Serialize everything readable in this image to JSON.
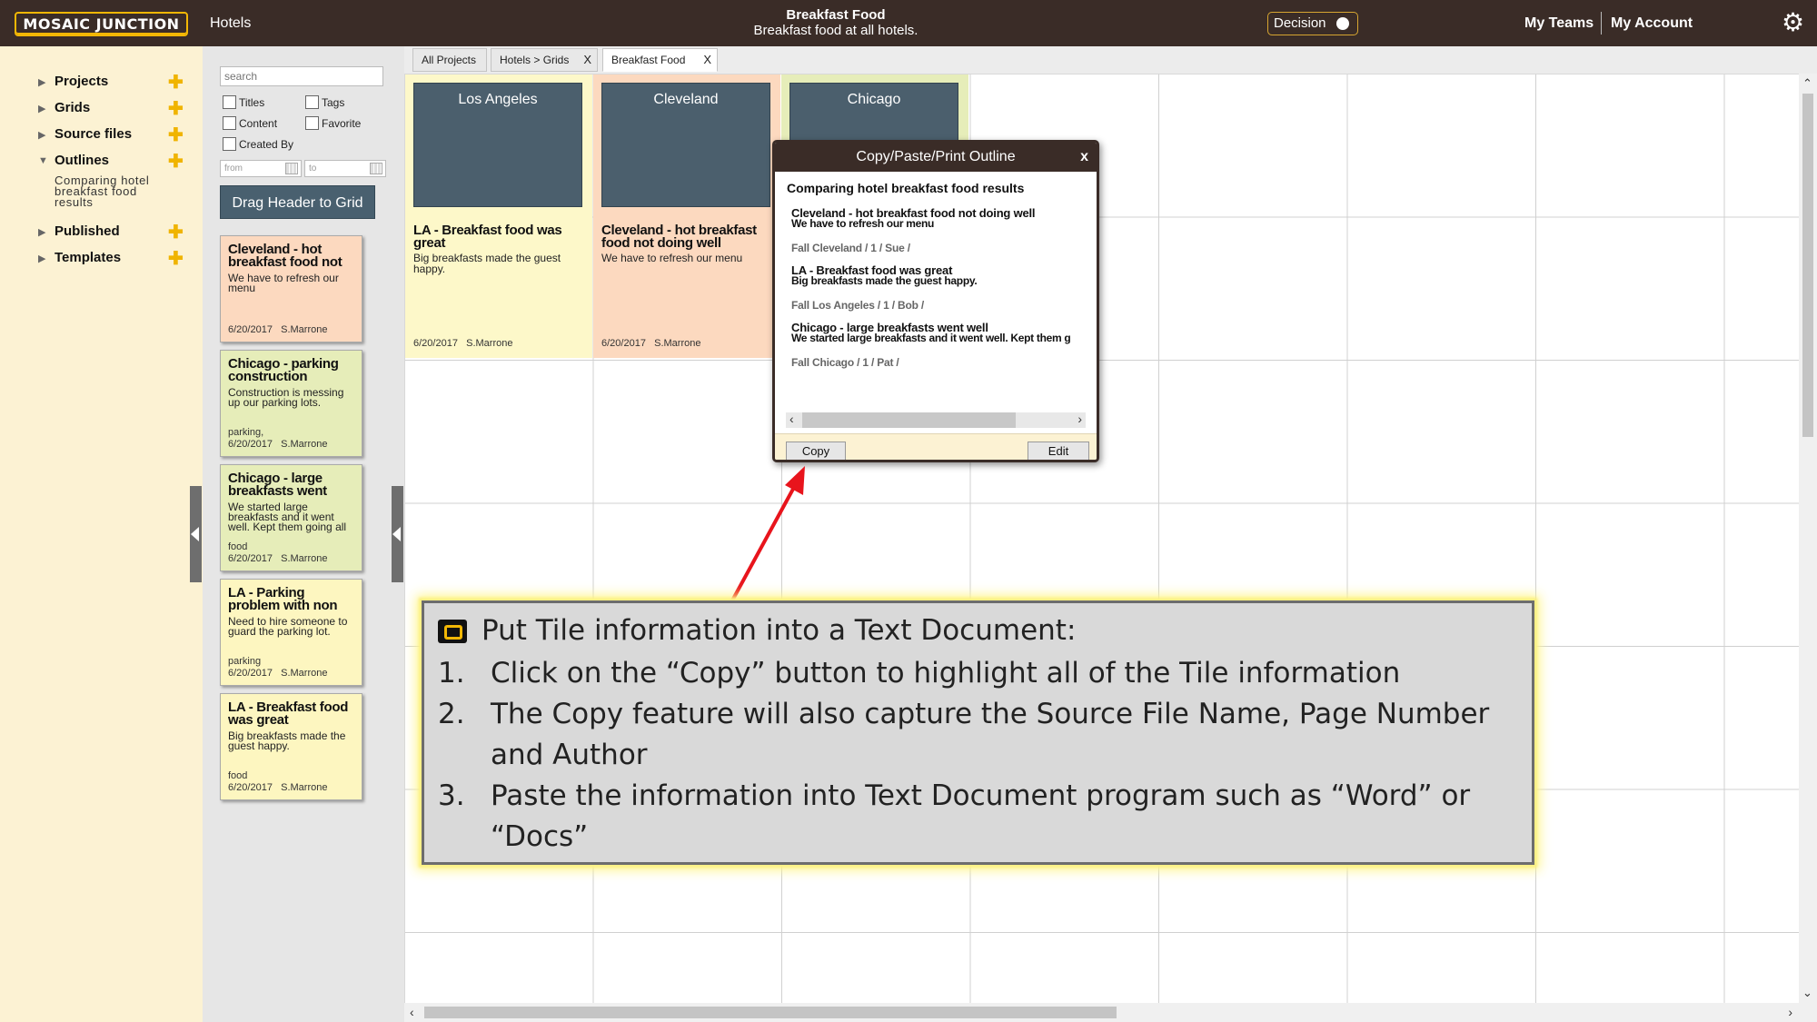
{
  "header": {
    "logo": "MOSAIC JUNCTION",
    "nav_hotels": "Hotels",
    "title": "Breakfast Food",
    "subtitle": "Breakfast food at all hotels.",
    "decision": "Decision",
    "my_teams": "My Teams",
    "my_account": "My Account",
    "gear_icon": "gear-icon"
  },
  "sidebar": {
    "items": [
      {
        "label": "Projects",
        "expanded": false
      },
      {
        "label": "Grids",
        "expanded": false
      },
      {
        "label": "Source files",
        "expanded": false
      },
      {
        "label": "Outlines",
        "expanded": true
      },
      {
        "label": "Published",
        "expanded": false
      },
      {
        "label": "Templates",
        "expanded": false
      }
    ],
    "outline_entry": "Comparing hotel breakfast food results"
  },
  "filters": {
    "search_placeholder": "search",
    "titles": "Titles",
    "tags": "Tags",
    "content": "Content",
    "favorite": "Favorite",
    "created_by": "Created By",
    "from_placeholder": "from",
    "to_placeholder": "to",
    "drag_header": "Drag Header to Grid"
  },
  "side_tiles": [
    {
      "title": "Cleveland - hot breakfast food not",
      "body": "We have to refresh our menu",
      "tag": "",
      "date": "6/20/2017",
      "author": "S.Marrone",
      "color": "#fcd9bf"
    },
    {
      "title": "Chicago - parking construction",
      "body": "Construction is messing up our parking lots.",
      "tag": "parking,",
      "date": "6/20/2017",
      "author": "S.Marrone",
      "color": "#e6edb9"
    },
    {
      "title": "Chicago - large breakfasts went",
      "body": "We started large breakfasts and it went well. Kept them going all",
      "tag": "food",
      "date": "6/20/2017",
      "author": "S.Marrone",
      "color": "#e6edb9"
    },
    {
      "title": "LA - Parking problem with non",
      "body": "Need to hire someone to guard the parking lot.",
      "tag": "parking",
      "date": "6/20/2017",
      "author": "S.Marrone",
      "color": "#fdf6c0"
    },
    {
      "title": "LA - Breakfast food was great",
      "body": "Big breakfasts made the guest happy.",
      "tag": "food",
      "date": "6/20/2017",
      "author": "S.Marrone",
      "color": "#fdf6c0"
    }
  ],
  "tabs": [
    {
      "label": "All Projects",
      "closable": false
    },
    {
      "label": "Hotels > Grids",
      "closable": true
    },
    {
      "label": "Breakfast Food",
      "closable": true
    }
  ],
  "tab_close": "X",
  "grid": {
    "columns": [
      {
        "header": "Los Angeles",
        "color": "#fdf8c9"
      },
      {
        "header": "Cleveland",
        "color": "#fcd9bf"
      },
      {
        "header": "Chicago",
        "color": "#e6edb9"
      }
    ],
    "tiles": [
      {
        "title": "LA - Breakfast food was great",
        "body": "Big breakfasts made the guest happy.",
        "date": "6/20/2017",
        "author": "S.Marrone"
      },
      {
        "title": "Cleveland - hot breakfast food not doing well",
        "body": "We have to refresh our menu",
        "date": "6/20/2017",
        "author": "S.Marrone"
      }
    ]
  },
  "popup": {
    "title": "Copy/Paste/Print Outline",
    "close": "x",
    "heading": "Comparing hotel breakfast food results",
    "entries": [
      {
        "title": "Cleveland - hot breakfast food not doing well",
        "body": "We have to refresh our menu",
        "source": "Fall Cleveland / 1 / Sue /"
      },
      {
        "title": "LA - Breakfast food was great",
        "body": "Big breakfasts made the guest happy.",
        "source": "Fall Los Angeles / 1 / Bob /"
      },
      {
        "title": "Chicago - large breakfasts went well",
        "body": "We started large breakfasts and it went well. Kept them g",
        "source": "Fall Chicago / 1 / Pat /"
      }
    ],
    "copy_button": "Copy",
    "edit_button": "Edit"
  },
  "instructions": {
    "title": "Put Tile information into a Text Document:",
    "steps": [
      {
        "num": "1.",
        "text": "Click on the “Copy” button to highlight all of the Tile information"
      },
      {
        "num": "2.",
        "text": "The Copy feature will also capture the Source File Name, Page Number and Author"
      },
      {
        "num": "3.",
        "text": "Paste the information into Text Document program such as “Word” or “Docs”"
      }
    ]
  },
  "colors": {
    "header_bg": "#3a2c27",
    "accent": "#f2b705",
    "nav_bg": "#fcf2d3",
    "column_header": "#4b5f6d",
    "arrow": "#e8141c"
  }
}
